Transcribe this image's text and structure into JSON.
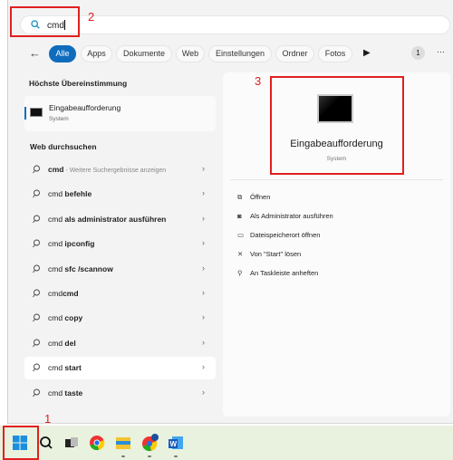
{
  "search": {
    "value": "cmd"
  },
  "tabs": [
    "Alle",
    "Apps",
    "Dokumente",
    "Web",
    "Einstellungen",
    "Ordner",
    "Fotos"
  ],
  "badge": "1",
  "more": "···",
  "best_match": {
    "heading": "Höchste Übereinstimmung",
    "title": "Eingabeaufforderung",
    "subtitle": "System"
  },
  "web": {
    "heading": "Web durchsuchen",
    "items": [
      {
        "prefix": "cmd",
        "bold": "",
        "sub": " - Weitere Suchergebnisse anzeigen"
      },
      {
        "prefix": "cmd ",
        "bold": "befehle",
        "sub": ""
      },
      {
        "prefix": "cmd ",
        "bold": "als administrator ausführen",
        "sub": ""
      },
      {
        "prefix": "cmd ",
        "bold": "ipconfig",
        "sub": ""
      },
      {
        "prefix": "cmd ",
        "bold": "sfc /scannow",
        "sub": ""
      },
      {
        "prefix": "cmd",
        "bold": "cmd",
        "sub": ""
      },
      {
        "prefix": "cmd ",
        "bold": "copy",
        "sub": ""
      },
      {
        "prefix": "cmd ",
        "bold": "del",
        "sub": ""
      },
      {
        "prefix": "cmd ",
        "bold": "start",
        "sub": ""
      },
      {
        "prefix": "cmd ",
        "bold": "taste",
        "sub": ""
      }
    ]
  },
  "detail": {
    "title": "Eingabeaufforderung",
    "subtitle": "System",
    "actions": [
      {
        "icon": "open-external-icon",
        "glyph": "⧉",
        "label": "Öffnen"
      },
      {
        "icon": "admin-shield-icon",
        "glyph": "◙",
        "label": "Als Administrator ausführen"
      },
      {
        "icon": "folder-icon",
        "glyph": "▭",
        "label": "Dateispeicherort öffnen"
      },
      {
        "icon": "unpin-icon",
        "glyph": "✕",
        "label": "Von \"Start\" lösen"
      },
      {
        "icon": "pin-icon",
        "glyph": "⚲",
        "label": "An Taskleiste anheften"
      }
    ]
  },
  "annotations": [
    "1",
    "2",
    "3"
  ],
  "colors": {
    "accent": "#0f6cbd",
    "annotation": "#e02020",
    "taskbar": "#e9f1df"
  }
}
